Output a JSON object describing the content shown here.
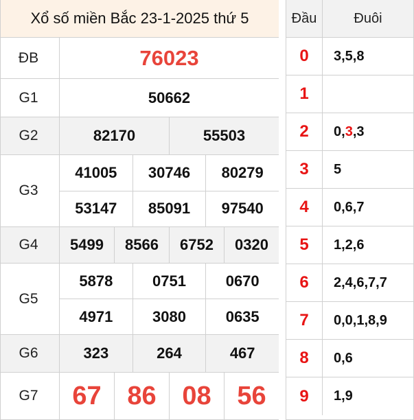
{
  "title": "Xổ số miền Bắc 23-1-2025 thứ 5",
  "prizes": {
    "db": {
      "label": "ĐB",
      "values": [
        "76023"
      ]
    },
    "g1": {
      "label": "G1",
      "values": [
        "50662"
      ]
    },
    "g2": {
      "label": "G2",
      "values": [
        "82170",
        "55503"
      ]
    },
    "g3": {
      "label": "G3",
      "values": [
        "41005",
        "30746",
        "80279",
        "53147",
        "85091",
        "97540"
      ]
    },
    "g4": {
      "label": "G4",
      "values": [
        "5499",
        "8566",
        "6752",
        "0320"
      ]
    },
    "g5": {
      "label": "G5",
      "values": [
        "5878",
        "0751",
        "0670",
        "4971",
        "3080",
        "0635"
      ]
    },
    "g6": {
      "label": "G6",
      "values": [
        "323",
        "264",
        "467"
      ]
    },
    "g7": {
      "label": "G7",
      "values": [
        "67",
        "86",
        "08",
        "56"
      ]
    }
  },
  "loto": {
    "head_label": "Đầu",
    "tail_label": "Đuôi",
    "rows": [
      {
        "head": "0",
        "tail": "3,5,8"
      },
      {
        "head": "1",
        "tail": ""
      },
      {
        "head": "2",
        "tail_parts": [
          "0,",
          "3",
          ",3"
        ]
      },
      {
        "head": "3",
        "tail": "5"
      },
      {
        "head": "4",
        "tail": "0,6,7"
      },
      {
        "head": "5",
        "tail": "1,2,6"
      },
      {
        "head": "6",
        "tail": "2,4,6,7,7"
      },
      {
        "head": "7",
        "tail": "0,0,1,8,9"
      },
      {
        "head": "8",
        "tail": "0,6"
      },
      {
        "head": "9",
        "tail": "1,9"
      }
    ]
  },
  "colors": {
    "accent": "#e8443a",
    "head_red": "#e81414",
    "title_bg": "#fdf2e6",
    "row_gray": "#f2f2f2"
  }
}
